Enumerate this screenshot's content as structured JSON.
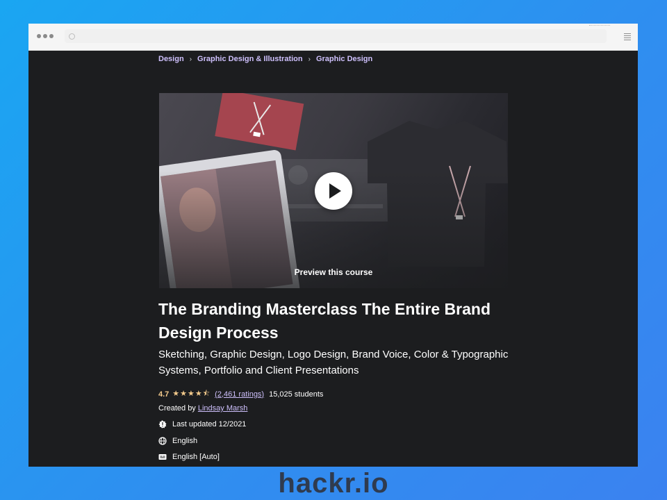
{
  "colors": {
    "page_bg": "#1c1d1f",
    "accent_purple": "#cec0fc",
    "star_gold": "#f3ca8c",
    "brand_text": "#2f3b4f"
  },
  "breadcrumb": [
    "Design",
    "Graphic Design & Illustration",
    "Graphic Design"
  ],
  "breadcrumb_separator": "›",
  "preview": {
    "label": "Preview this course",
    "play_icon": "play-icon"
  },
  "course": {
    "title": "The Branding Masterclass The Entire Brand Design Process",
    "subtitle": "Sketching, Graphic Design, Logo Design, Brand Voice, Color & Typographic Systems, Portfolio and Client Presentations",
    "rating": "4.7",
    "stars": "★★★★⯪",
    "ratings_count": "(2,461 ratings)",
    "students": "15,025 students",
    "created_prefix": "Created by",
    "instructor": "Lindsay Marsh",
    "last_updated": "Last updated 12/2021",
    "language": "English",
    "captions": "English [Auto]"
  },
  "footer_logo": "hackr.io"
}
